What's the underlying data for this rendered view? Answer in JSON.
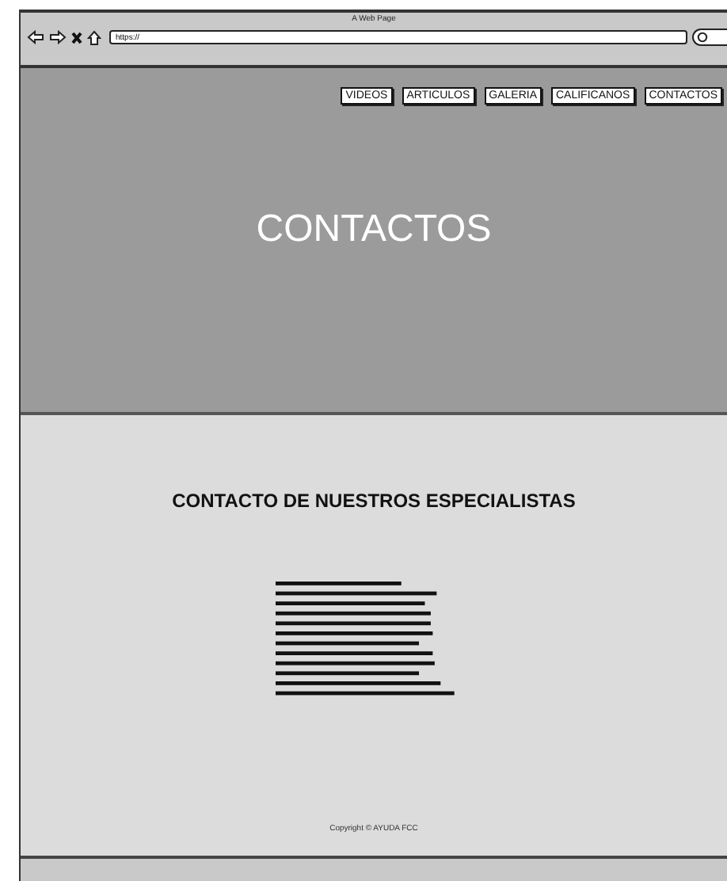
{
  "window": {
    "title": "A Web Page",
    "address": "https://"
  },
  "nav": [
    {
      "label": "VIDEOS"
    },
    {
      "label": "ARTICULOS"
    },
    {
      "label": "GALERIA"
    },
    {
      "label": "CALIFICANOS"
    },
    {
      "label": "CONTACTOS"
    }
  ],
  "hero": {
    "title": "CONTACTOS"
  },
  "section": {
    "heading": "CONTACTO DE NUESTROS ESPECIALISTAS"
  },
  "footer": {
    "copyright": "Copyright © AYUDA FCC"
  }
}
